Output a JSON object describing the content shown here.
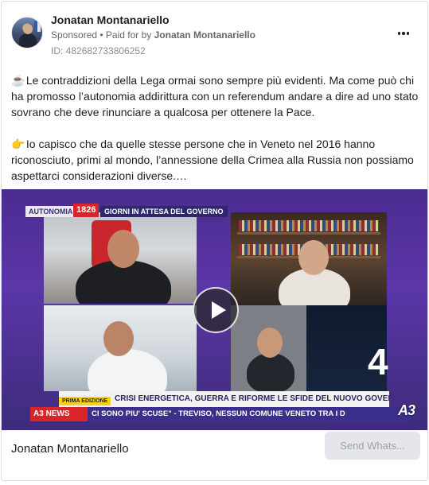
{
  "post": {
    "page_name": "Jonatan Montanariello",
    "sponsored_label": "Sponsored",
    "paid_for_prefix": " • Paid for by ",
    "paid_for_name": "Jonatan Montanariello",
    "ad_id": "ID: 482682733806252",
    "paragraph_1_emoji": "☕",
    "paragraph_1": " Le contraddizioni della Lega ormai sono sempre più evidenti. Ma come può chi ha promosso l’autonomia addirittura con un referendum andare a dire ad uno stato sovrano che deve rinunciare a qualcosa per ottenere la Pace.",
    "paragraph_2_emoji": "👉",
    "paragraph_2": " Io capisco che da quelle stesse persone che in Veneto nel 2016 hanno riconosciuto, primi al mondo, l’annessione della Crimea alla Russia non possiamo aspettarci considerazioni diverse.…"
  },
  "video": {
    "badge_autonomia": "AUTONOMIA:",
    "badge_number": "1826",
    "badge_giorni": "GIORNI IN ATTESA DEL GOVERNO",
    "edition": "PRIMA EDIZIONE",
    "headline": "CRISI ENERGETICA, GUERRA E RIFORME LE SFIDE DEL NUOVO GOVERNO",
    "news_label": "NEWS",
    "ticker": "CI SONO PIU' SCUSE\" - TREVISO, NESSUN COMUNE VENETO TRA I D",
    "channel_logo": "A3",
    "channel_number": "4",
    "overlay_logo_prefix": "A3"
  },
  "footer": {
    "name": "Jonatan Montanariello",
    "cta_label": "Send Whats..."
  },
  "icons": {
    "more": "more-horizontal-icon",
    "play": "play-icon"
  },
  "colors": {
    "video_bg": "#4a2c8f",
    "news_red": "#d9252a",
    "ticker_blue": "#3a2f8a",
    "edition_yellow": "#f7d21b",
    "cta_bg": "#e4e6eb"
  }
}
